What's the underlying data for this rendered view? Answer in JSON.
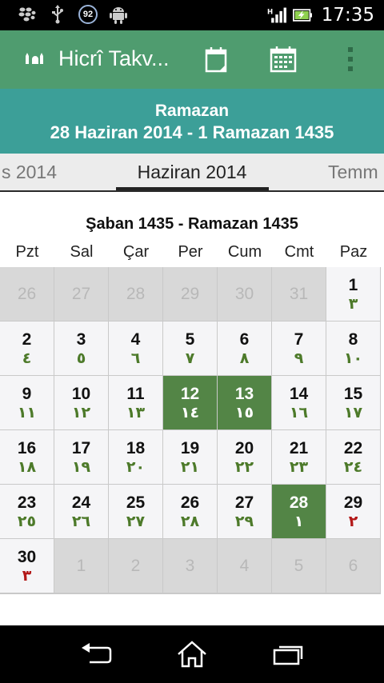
{
  "status_bar": {
    "time": "17:35",
    "notification_badge": "92",
    "icons": [
      "bbm-icon",
      "usb-icon",
      "notification-92-icon",
      "android-icon",
      "signal-icon",
      "battery-charging-icon"
    ]
  },
  "action_bar": {
    "title": "Hicrî Takv...",
    "color": "#4f9c6f",
    "buttons": [
      "today-icon",
      "calendar-icon",
      "overflow-menu-icon"
    ]
  },
  "info": {
    "month": "Ramazan",
    "range": "28 Haziran 2014 - 1 Ramazan 1435",
    "color": "#3c9f98"
  },
  "tabs": {
    "prev": "s 2014",
    "current": "Haziran 2014",
    "next": "Temm"
  },
  "calendar": {
    "title": "Şaban 1435 - Ramazan 1435",
    "weekdays": [
      "Pzt",
      "Sal",
      "Çar",
      "Per",
      "Cum",
      "Cmt",
      "Paz"
    ],
    "highlight_color": "#538546",
    "weeks": [
      [
        {
          "g": "26",
          "h": "",
          "state": "muted"
        },
        {
          "g": "27",
          "h": "",
          "state": "muted"
        },
        {
          "g": "28",
          "h": "",
          "state": "muted"
        },
        {
          "g": "29",
          "h": "",
          "state": "muted"
        },
        {
          "g": "30",
          "h": "",
          "state": "muted"
        },
        {
          "g": "31",
          "h": "",
          "state": "muted"
        },
        {
          "g": "1",
          "h": "٣",
          "state": "normal"
        }
      ],
      [
        {
          "g": "2",
          "h": "٤",
          "state": "normal"
        },
        {
          "g": "3",
          "h": "٥",
          "state": "normal"
        },
        {
          "g": "4",
          "h": "٦",
          "state": "normal"
        },
        {
          "g": "5",
          "h": "٧",
          "state": "normal"
        },
        {
          "g": "6",
          "h": "٨",
          "state": "normal"
        },
        {
          "g": "7",
          "h": "٩",
          "state": "normal"
        },
        {
          "g": "8",
          "h": "١٠",
          "state": "normal"
        }
      ],
      [
        {
          "g": "9",
          "h": "١١",
          "state": "normal"
        },
        {
          "g": "10",
          "h": "١٢",
          "state": "normal"
        },
        {
          "g": "11",
          "h": "١٣",
          "state": "normal"
        },
        {
          "g": "12",
          "h": "١٤",
          "state": "highlight"
        },
        {
          "g": "13",
          "h": "١٥",
          "state": "highlight"
        },
        {
          "g": "14",
          "h": "١٦",
          "state": "normal"
        },
        {
          "g": "15",
          "h": "١٧",
          "state": "normal"
        }
      ],
      [
        {
          "g": "16",
          "h": "١٨",
          "state": "normal"
        },
        {
          "g": "17",
          "h": "١٩",
          "state": "normal"
        },
        {
          "g": "18",
          "h": "٢٠",
          "state": "normal"
        },
        {
          "g": "19",
          "h": "٢١",
          "state": "normal"
        },
        {
          "g": "20",
          "h": "٢٢",
          "state": "normal"
        },
        {
          "g": "21",
          "h": "٢٣",
          "state": "normal"
        },
        {
          "g": "22",
          "h": "٢٤",
          "state": "normal"
        }
      ],
      [
        {
          "g": "23",
          "h": "٢٥",
          "state": "normal"
        },
        {
          "g": "24",
          "h": "٢٦",
          "state": "normal"
        },
        {
          "g": "25",
          "h": "٢٧",
          "state": "normal"
        },
        {
          "g": "26",
          "h": "٢٨",
          "state": "normal"
        },
        {
          "g": "27",
          "h": "٢٩",
          "state": "normal"
        },
        {
          "g": "28",
          "h": "١",
          "state": "highlight"
        },
        {
          "g": "29",
          "h": "٢",
          "state": "normal",
          "red": true
        }
      ],
      [
        {
          "g": "30",
          "h": "٣",
          "state": "normal",
          "red": true
        },
        {
          "g": "1",
          "h": "",
          "state": "muted"
        },
        {
          "g": "2",
          "h": "",
          "state": "muted"
        },
        {
          "g": "3",
          "h": "",
          "state": "muted"
        },
        {
          "g": "4",
          "h": "",
          "state": "muted"
        },
        {
          "g": "5",
          "h": "",
          "state": "muted"
        },
        {
          "g": "6",
          "h": "",
          "state": "muted"
        }
      ]
    ]
  },
  "nav_bar": {
    "buttons": [
      "back-icon",
      "home-icon",
      "recent-apps-icon"
    ]
  }
}
